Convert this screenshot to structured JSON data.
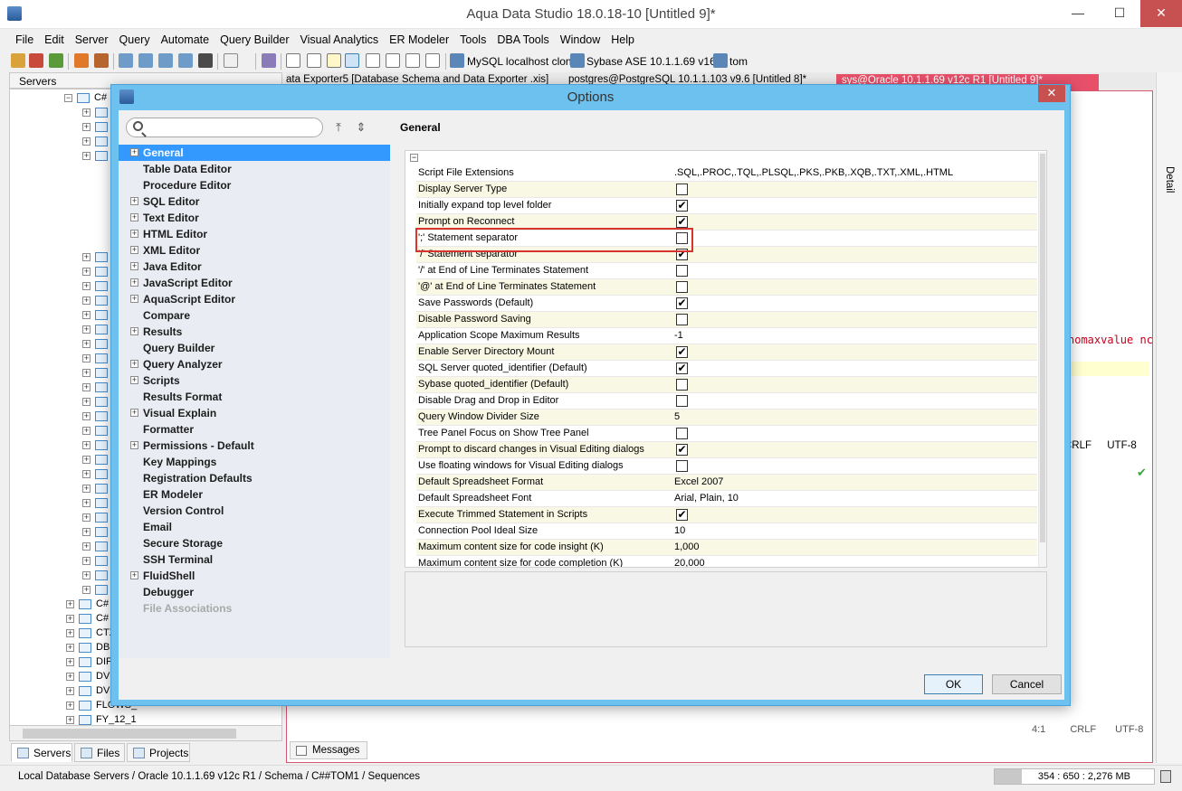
{
  "app": {
    "title": "Aqua Data Studio 18.0.18-10 [Untitled 9]*",
    "window_buttons": {
      "minimize": "—",
      "maximize": "☐",
      "close": "✕"
    }
  },
  "menu": [
    "File",
    "Edit",
    "Server",
    "Query",
    "Automate",
    "Query Builder",
    "Visual Analytics",
    "ER Modeler",
    "Tools",
    "DBA Tools",
    "Window",
    "Help"
  ],
  "toolbar": {
    "connections": [
      "MySQL localhost clone",
      "Sybase ASE 10.1.1.69 v16",
      "tom"
    ]
  },
  "left_panel": {
    "header": "Servers",
    "tree_top": [
      "C#"
    ],
    "tree_bottom": [
      "C#",
      "C#",
      "CTX",
      "DBS",
      "DIF",
      "DVF",
      "DVS",
      "FLOWS_",
      "FY_12_1"
    ],
    "tabs": [
      "Servers",
      "Files",
      "Projects"
    ]
  },
  "editor": {
    "tabs": [
      "ata Exporter5 [Database Schema and Data Exporter .xis]",
      "postgres@PostgreSQL 10.1.1.103 v9.6 [Untitled 8]*",
      "sys@Oracle 10.1.1.69 v12c R1 [Untitled 9]*"
    ],
    "code_fragment": "nomaxvalue nc",
    "status_top": [
      "CRLF",
      "UTF-8"
    ],
    "status_bottom": [
      "4:1",
      "CRLF",
      "UTF-8"
    ],
    "messages_tab": "Messages",
    "side_panel": "Detail"
  },
  "statusbar": {
    "path": "Local Database Servers / Oracle 10.1.1.69 v12c R1 / Schema / C##TOM1 / Sequences",
    "memory": "354 : 650 : 2,276 MB"
  },
  "dialog": {
    "title": "Options",
    "search_placeholder": "",
    "section_title": "General",
    "nav": [
      {
        "label": "General",
        "expandable": true,
        "selected": true
      },
      {
        "label": "Table Data Editor",
        "expandable": false
      },
      {
        "label": "Procedure Editor",
        "expandable": false
      },
      {
        "label": "SQL Editor",
        "expandable": true
      },
      {
        "label": "Text Editor",
        "expandable": true
      },
      {
        "label": "HTML Editor",
        "expandable": true
      },
      {
        "label": "XML Editor",
        "expandable": true
      },
      {
        "label": "Java Editor",
        "expandable": true
      },
      {
        "label": "JavaScript Editor",
        "expandable": true
      },
      {
        "label": "AquaScript Editor",
        "expandable": true
      },
      {
        "label": "Compare",
        "expandable": false
      },
      {
        "label": "Results",
        "expandable": true
      },
      {
        "label": "Query Builder",
        "expandable": false
      },
      {
        "label": "Query Analyzer",
        "expandable": true
      },
      {
        "label": "Scripts",
        "expandable": true
      },
      {
        "label": "Results Format",
        "expandable": false
      },
      {
        "label": "Visual Explain",
        "expandable": true
      },
      {
        "label": "Formatter",
        "expandable": false
      },
      {
        "label": "Permissions - Default",
        "expandable": true
      },
      {
        "label": "Key Mappings",
        "expandable": false
      },
      {
        "label": "Registration Defaults",
        "expandable": false
      },
      {
        "label": "ER Modeler",
        "expandable": false
      },
      {
        "label": "Version Control",
        "expandable": false
      },
      {
        "label": "Email",
        "expandable": false
      },
      {
        "label": "Secure Storage",
        "expandable": false
      },
      {
        "label": "SSH Terminal",
        "expandable": false
      },
      {
        "label": "FluidShell",
        "expandable": true
      },
      {
        "label": "Debugger",
        "expandable": false
      },
      {
        "label": "File Associations",
        "expandable": false,
        "disabled": true
      }
    ],
    "properties": [
      {
        "name": "Script File Extensions",
        "type": "text",
        "value": ".SQL,.PROC,.TQL,.PLSQL,.PKS,.PKB,.XQB,.TXT,.XML,.HTML"
      },
      {
        "name": "Display Server Type",
        "type": "check",
        "checked": false
      },
      {
        "name": "Initially expand top level folder",
        "type": "check",
        "checked": true
      },
      {
        "name": "Prompt on Reconnect",
        "type": "check",
        "checked": true
      },
      {
        "name": "';' Statement separator",
        "type": "check",
        "checked": false
      },
      {
        "name": "'/' Statement separator",
        "type": "check",
        "checked": true
      },
      {
        "name": "'/' at End of Line Terminates Statement",
        "type": "check",
        "checked": false
      },
      {
        "name": "'@' at End of Line Terminates Statement",
        "type": "check",
        "checked": false
      },
      {
        "name": "Save Passwords (Default)",
        "type": "check",
        "checked": true
      },
      {
        "name": "Disable Password Saving",
        "type": "check",
        "checked": false
      },
      {
        "name": "Application Scope Maximum Results",
        "type": "text",
        "value": "-1"
      },
      {
        "name": "Enable Server Directory Mount",
        "type": "check",
        "checked": true
      },
      {
        "name": "SQL Server quoted_identifier (Default)",
        "type": "check",
        "checked": true
      },
      {
        "name": "Sybase quoted_identifier (Default)",
        "type": "check",
        "checked": false
      },
      {
        "name": "Disable Drag and Drop in Editor",
        "type": "check",
        "checked": false
      },
      {
        "name": "Query Window Divider Size",
        "type": "text",
        "value": "5"
      },
      {
        "name": "Tree Panel Focus on Show Tree Panel",
        "type": "check",
        "checked": false
      },
      {
        "name": "Prompt to discard changes in Visual Editing dialogs",
        "type": "check",
        "checked": true
      },
      {
        "name": "Use floating windows for Visual Editing dialogs",
        "type": "check",
        "checked": false
      },
      {
        "name": "Default Spreadsheet Format",
        "type": "text",
        "value": "Excel 2007"
      },
      {
        "name": "Default Spreadsheet Font",
        "type": "text",
        "value": "Arial, Plain, 10"
      },
      {
        "name": "Execute Trimmed Statement in Scripts",
        "type": "check",
        "checked": true
      },
      {
        "name": "Connection Pool Ideal Size",
        "type": "text",
        "value": "10"
      },
      {
        "name": "Maximum content size for code insight (K)",
        "type": "text",
        "value": "1,000"
      },
      {
        "name": "Maximum content size for code completion (K)",
        "type": "text",
        "value": "20,000"
      }
    ],
    "ok_label": "OK",
    "cancel_label": "Cancel"
  },
  "colors": {
    "dialog_frame": "#6cc1ef",
    "selection": "#3399ff",
    "highlight_box": "#d9342b",
    "active_tab": "#e8506a"
  }
}
